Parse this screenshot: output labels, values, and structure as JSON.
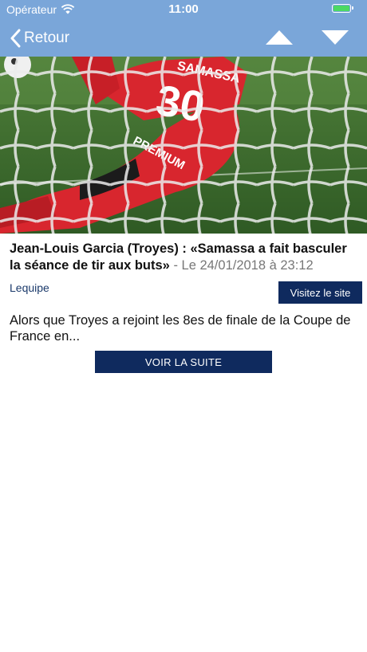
{
  "status_bar": {
    "carrier": "Opérateur",
    "time": "11:00",
    "battery_level": 1.0
  },
  "nav": {
    "back_label": "Retour",
    "icons": [
      "chevron-left-icon",
      "arrow-up-icon",
      "arrow-down-icon"
    ]
  },
  "article": {
    "title": "Jean-Louis Garcia (Troyes) : «Samassa a fait basculer la séance de tir aux buts»",
    "date_label": "- Le 24/01/2018 à 23:12",
    "source": "Lequipe",
    "visit_button": "Visitez le site",
    "excerpt": "Alors que Troyes a rejoint les 8es de finale de la Coupe de France en...",
    "more_button": "VOIR LA SUITE"
  },
  "photo": {
    "jersey_name": "SAMASSA",
    "jersey_number": "30",
    "sponsor": "PREMIUM"
  },
  "colors": {
    "nav_background": "#7aa6d9",
    "button_background": "#0f2a5e",
    "source_link": "#1b3a6b",
    "battery": "#4cd964"
  }
}
